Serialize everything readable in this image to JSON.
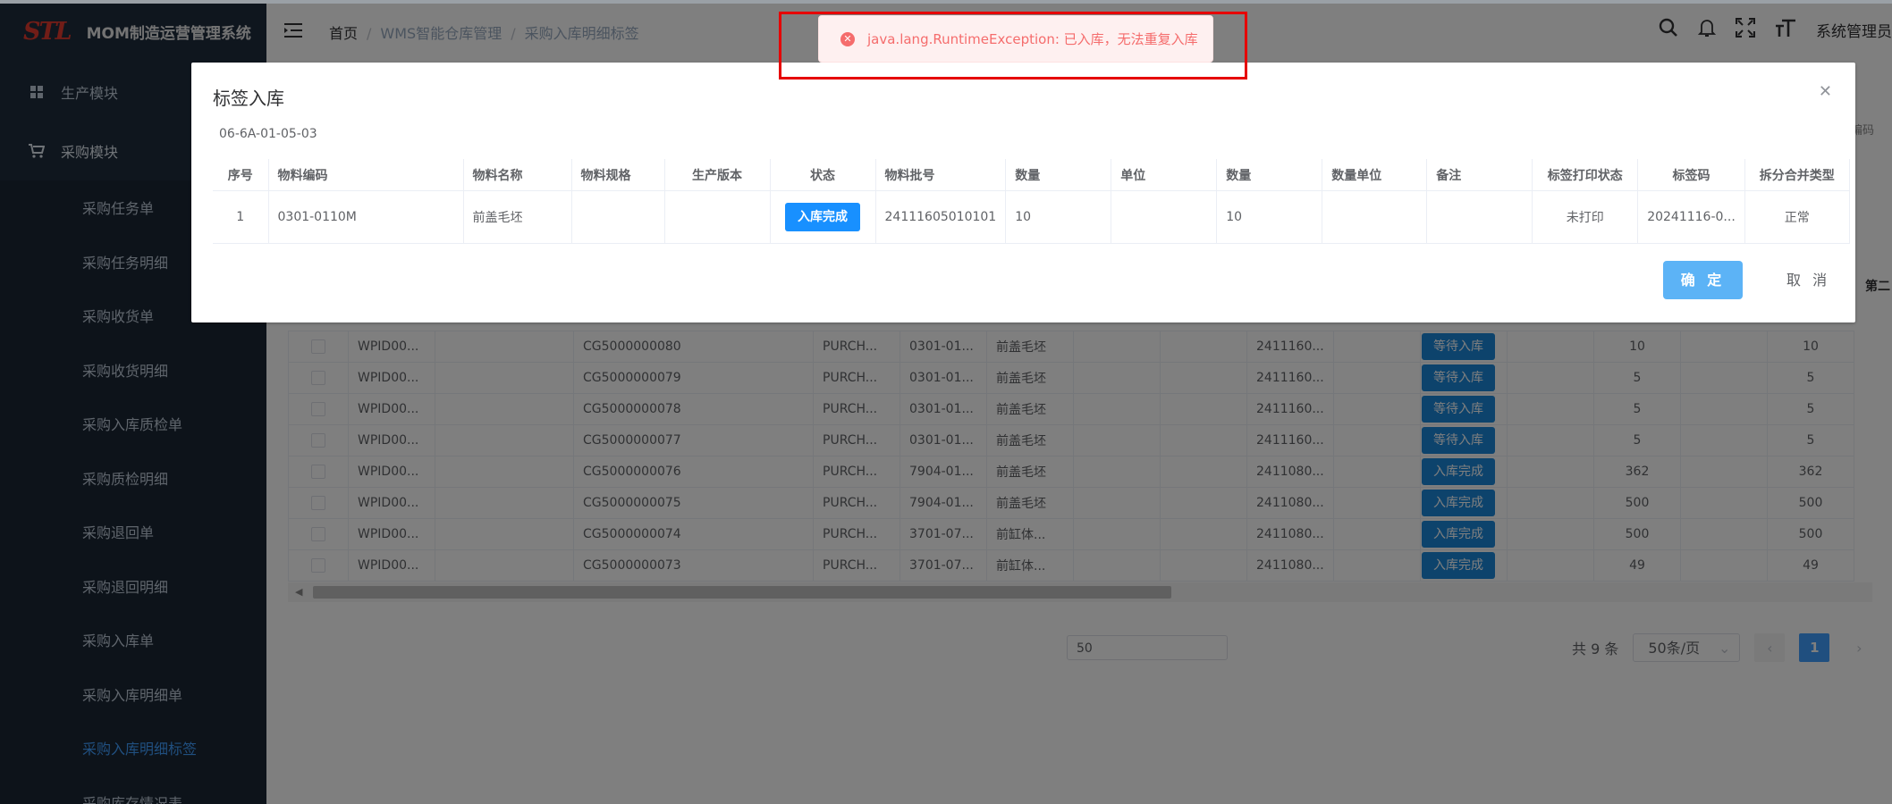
{
  "app": {
    "logo": "STL",
    "title": "MOM制造运营管理系统"
  },
  "sidebar": {
    "groups": [
      {
        "label": "生产模块",
        "icon": "grid-icon"
      },
      {
        "label": "采购模块",
        "icon": "cart-icon"
      }
    ],
    "items": [
      "采购任务单",
      "采购任务明细",
      "采购收货单",
      "采购收货明细",
      "采购入库质检单",
      "采购质检明细",
      "采购退回单",
      "采购退回明细",
      "采购入库单",
      "采购入库明细单",
      "采购入库明细标签",
      "采购库存情况表"
    ],
    "active_index": 10
  },
  "header": {
    "breadcrumbs": [
      "首页",
      "WMS智能仓库管理",
      "采购入库明细标签"
    ],
    "user": "系统管理员"
  },
  "toast": {
    "message": "java.lang.RuntimeException: 已入库，无法重复入库"
  },
  "dialog": {
    "title": "标签入库",
    "location": "06-6A-01-05-03",
    "columns": [
      "序号",
      "物料编码",
      "物料名称",
      "物料规格",
      "生产版本",
      "状态",
      "物料批号",
      "数量",
      "单位",
      "数量",
      "数量单位",
      "备注",
      "标签打印状态",
      "标签码",
      "拆分合并类型"
    ],
    "row": {
      "seq": "1",
      "code": "0301-0110M",
      "name": "前盖毛坯",
      "spec": "",
      "version": "",
      "status": "入库完成",
      "batch": "24111605010101",
      "qty": "10",
      "unit": "",
      "qty2": "10",
      "qty_unit": "",
      "remark": "",
      "print_status": "未打印",
      "label_code": "20241116-0...",
      "split_type": "正常"
    },
    "ok_label": "确 定",
    "cancel_label": "取 消"
  },
  "bg_table": {
    "rows": [
      {
        "wpid": "WPID00...",
        "cg": "CG5000000080",
        "purch": "PURCH...",
        "mat": "0301-01...",
        "name": "前盖毛坯",
        "batch": "2411160...",
        "status": "等待入库",
        "qa": "10",
        "qb": "10"
      },
      {
        "wpid": "WPID00...",
        "cg": "CG5000000079",
        "purch": "PURCH...",
        "mat": "0301-01...",
        "name": "前盖毛坯",
        "batch": "2411160...",
        "status": "等待入库",
        "qa": "5",
        "qb": "5"
      },
      {
        "wpid": "WPID00...",
        "cg": "CG5000000078",
        "purch": "PURCH...",
        "mat": "0301-01...",
        "name": "前盖毛坯",
        "batch": "2411160...",
        "status": "等待入库",
        "qa": "5",
        "qb": "5"
      },
      {
        "wpid": "WPID00...",
        "cg": "CG5000000077",
        "purch": "PURCH...",
        "mat": "0301-01...",
        "name": "前盖毛坯",
        "batch": "2411160...",
        "status": "等待入库",
        "qa": "5",
        "qb": "5"
      },
      {
        "wpid": "WPID00...",
        "cg": "CG5000000076",
        "purch": "PURCH...",
        "mat": "7904-01...",
        "name": "前盖毛坯",
        "batch": "2411080...",
        "status": "入库完成",
        "qa": "362",
        "qb": "362"
      },
      {
        "wpid": "WPID00...",
        "cg": "CG5000000075",
        "purch": "PURCH...",
        "mat": "7904-01...",
        "name": "前盖毛坯",
        "batch": "2411080...",
        "status": "入库完成",
        "qa": "500",
        "qb": "500"
      },
      {
        "wpid": "WPID00...",
        "cg": "CG5000000074",
        "purch": "PURCH...",
        "mat": "3701-07...",
        "name": "前缸体...",
        "batch": "2411080...",
        "status": "入库完成",
        "qa": "500",
        "qb": "500"
      },
      {
        "wpid": "WPID00...",
        "cg": "CG5000000073",
        "purch": "PURCH...",
        "mat": "3701-07...",
        "name": "前缸体...",
        "batch": "2411080...",
        "status": "入库完成",
        "qa": "49",
        "qb": "49"
      }
    ],
    "right_header_fragment": "第二",
    "right_fragment_top": "编码"
  },
  "pagination": {
    "input_value": "50",
    "total": "共 9 条",
    "page_size": "50条/页",
    "current_page": "1"
  }
}
